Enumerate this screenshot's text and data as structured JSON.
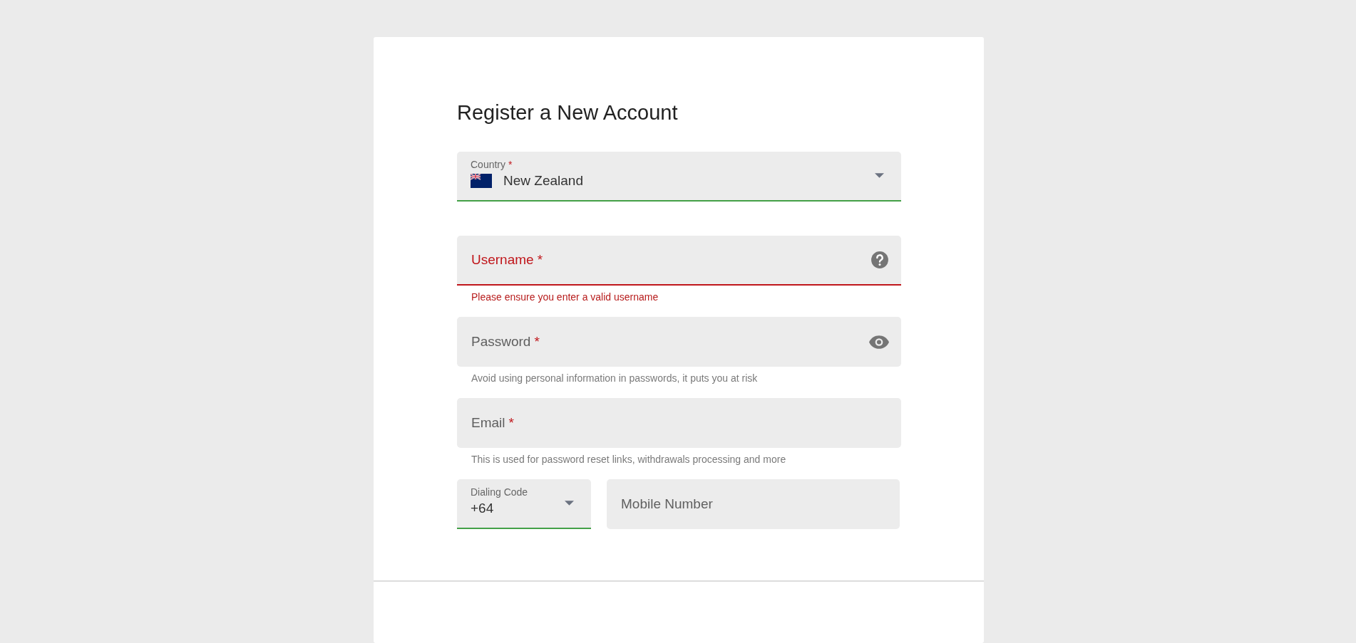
{
  "title": "Register a New Account",
  "country": {
    "label": "Country",
    "required_mark": "*",
    "value": "New Zealand",
    "valid": true
  },
  "fields": [
    {
      "kind": "help",
      "label": "Username",
      "required_mark": "*",
      "error": true,
      "helper": "Please ensure you enter a valid username"
    },
    {
      "kind": "reveal",
      "label": "Password",
      "required_mark": "*",
      "error": false,
      "helper": "Avoid using personal information in passwords, it puts you at risk"
    },
    {
      "kind": "plain",
      "label": "Email",
      "required_mark": "*",
      "error": false,
      "helper": "This is used for password reset links, withdrawals processing and more"
    }
  ],
  "phone": {
    "dialing_code": {
      "label": "Dialing Code",
      "value": "+64",
      "valid": true
    },
    "mobile": {
      "placeholder": "Mobile Number"
    }
  }
}
